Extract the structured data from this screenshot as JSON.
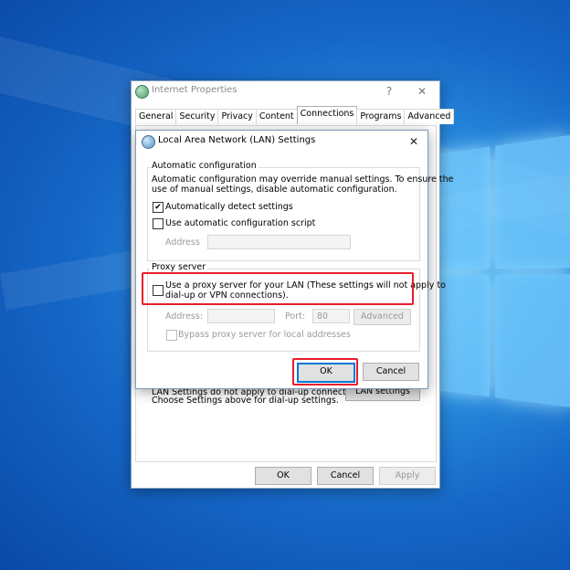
{
  "outer_dialog": {
    "title": "Internet Properties",
    "help_glyph": "?",
    "close_glyph": "✕",
    "tabs": [
      "General",
      "Security",
      "Privacy",
      "Content",
      "Connections",
      "Programs",
      "Advanced"
    ],
    "active_tab": "Connections",
    "lan_note_line1": "LAN Settings do not apply to dial-up connections.",
    "lan_note_line2": "Choose Settings above for dial-up settings.",
    "lan_settings_button": "LAN settings",
    "ok": "OK",
    "cancel": "Cancel",
    "apply": "Apply"
  },
  "lan_dialog": {
    "title": "Local Area Network (LAN) Settings",
    "close_glyph": "✕",
    "auto_config": {
      "legend": "Automatic configuration",
      "description_line1": "Automatic configuration may override manual settings.  To ensure the",
      "description_line2": "use of manual settings, disable automatic configuration.",
      "auto_detect_label": "Automatically detect settings",
      "auto_detect_checked": true,
      "script_label": "Use automatic configuration script",
      "script_checked": false,
      "address_label": "Address",
      "address_value": ""
    },
    "proxy": {
      "legend": "Proxy server",
      "use_proxy_line1": "Use a proxy server for your LAN (These settings will not apply to",
      "use_proxy_line2": "dial-up or VPN connections).",
      "use_proxy_checked": false,
      "address_label": "Address:",
      "address_value": "",
      "port_label": "Port:",
      "port_value": "80",
      "advanced_button": "Advanced",
      "bypass_label": "Bypass proxy server for local addresses",
      "bypass_checked": false
    },
    "ok": "OK",
    "cancel": "Cancel"
  },
  "colors": {
    "highlight": "#e81c2c",
    "default_button_border": "#0078d7",
    "desktop_blue": "#1566c6"
  }
}
